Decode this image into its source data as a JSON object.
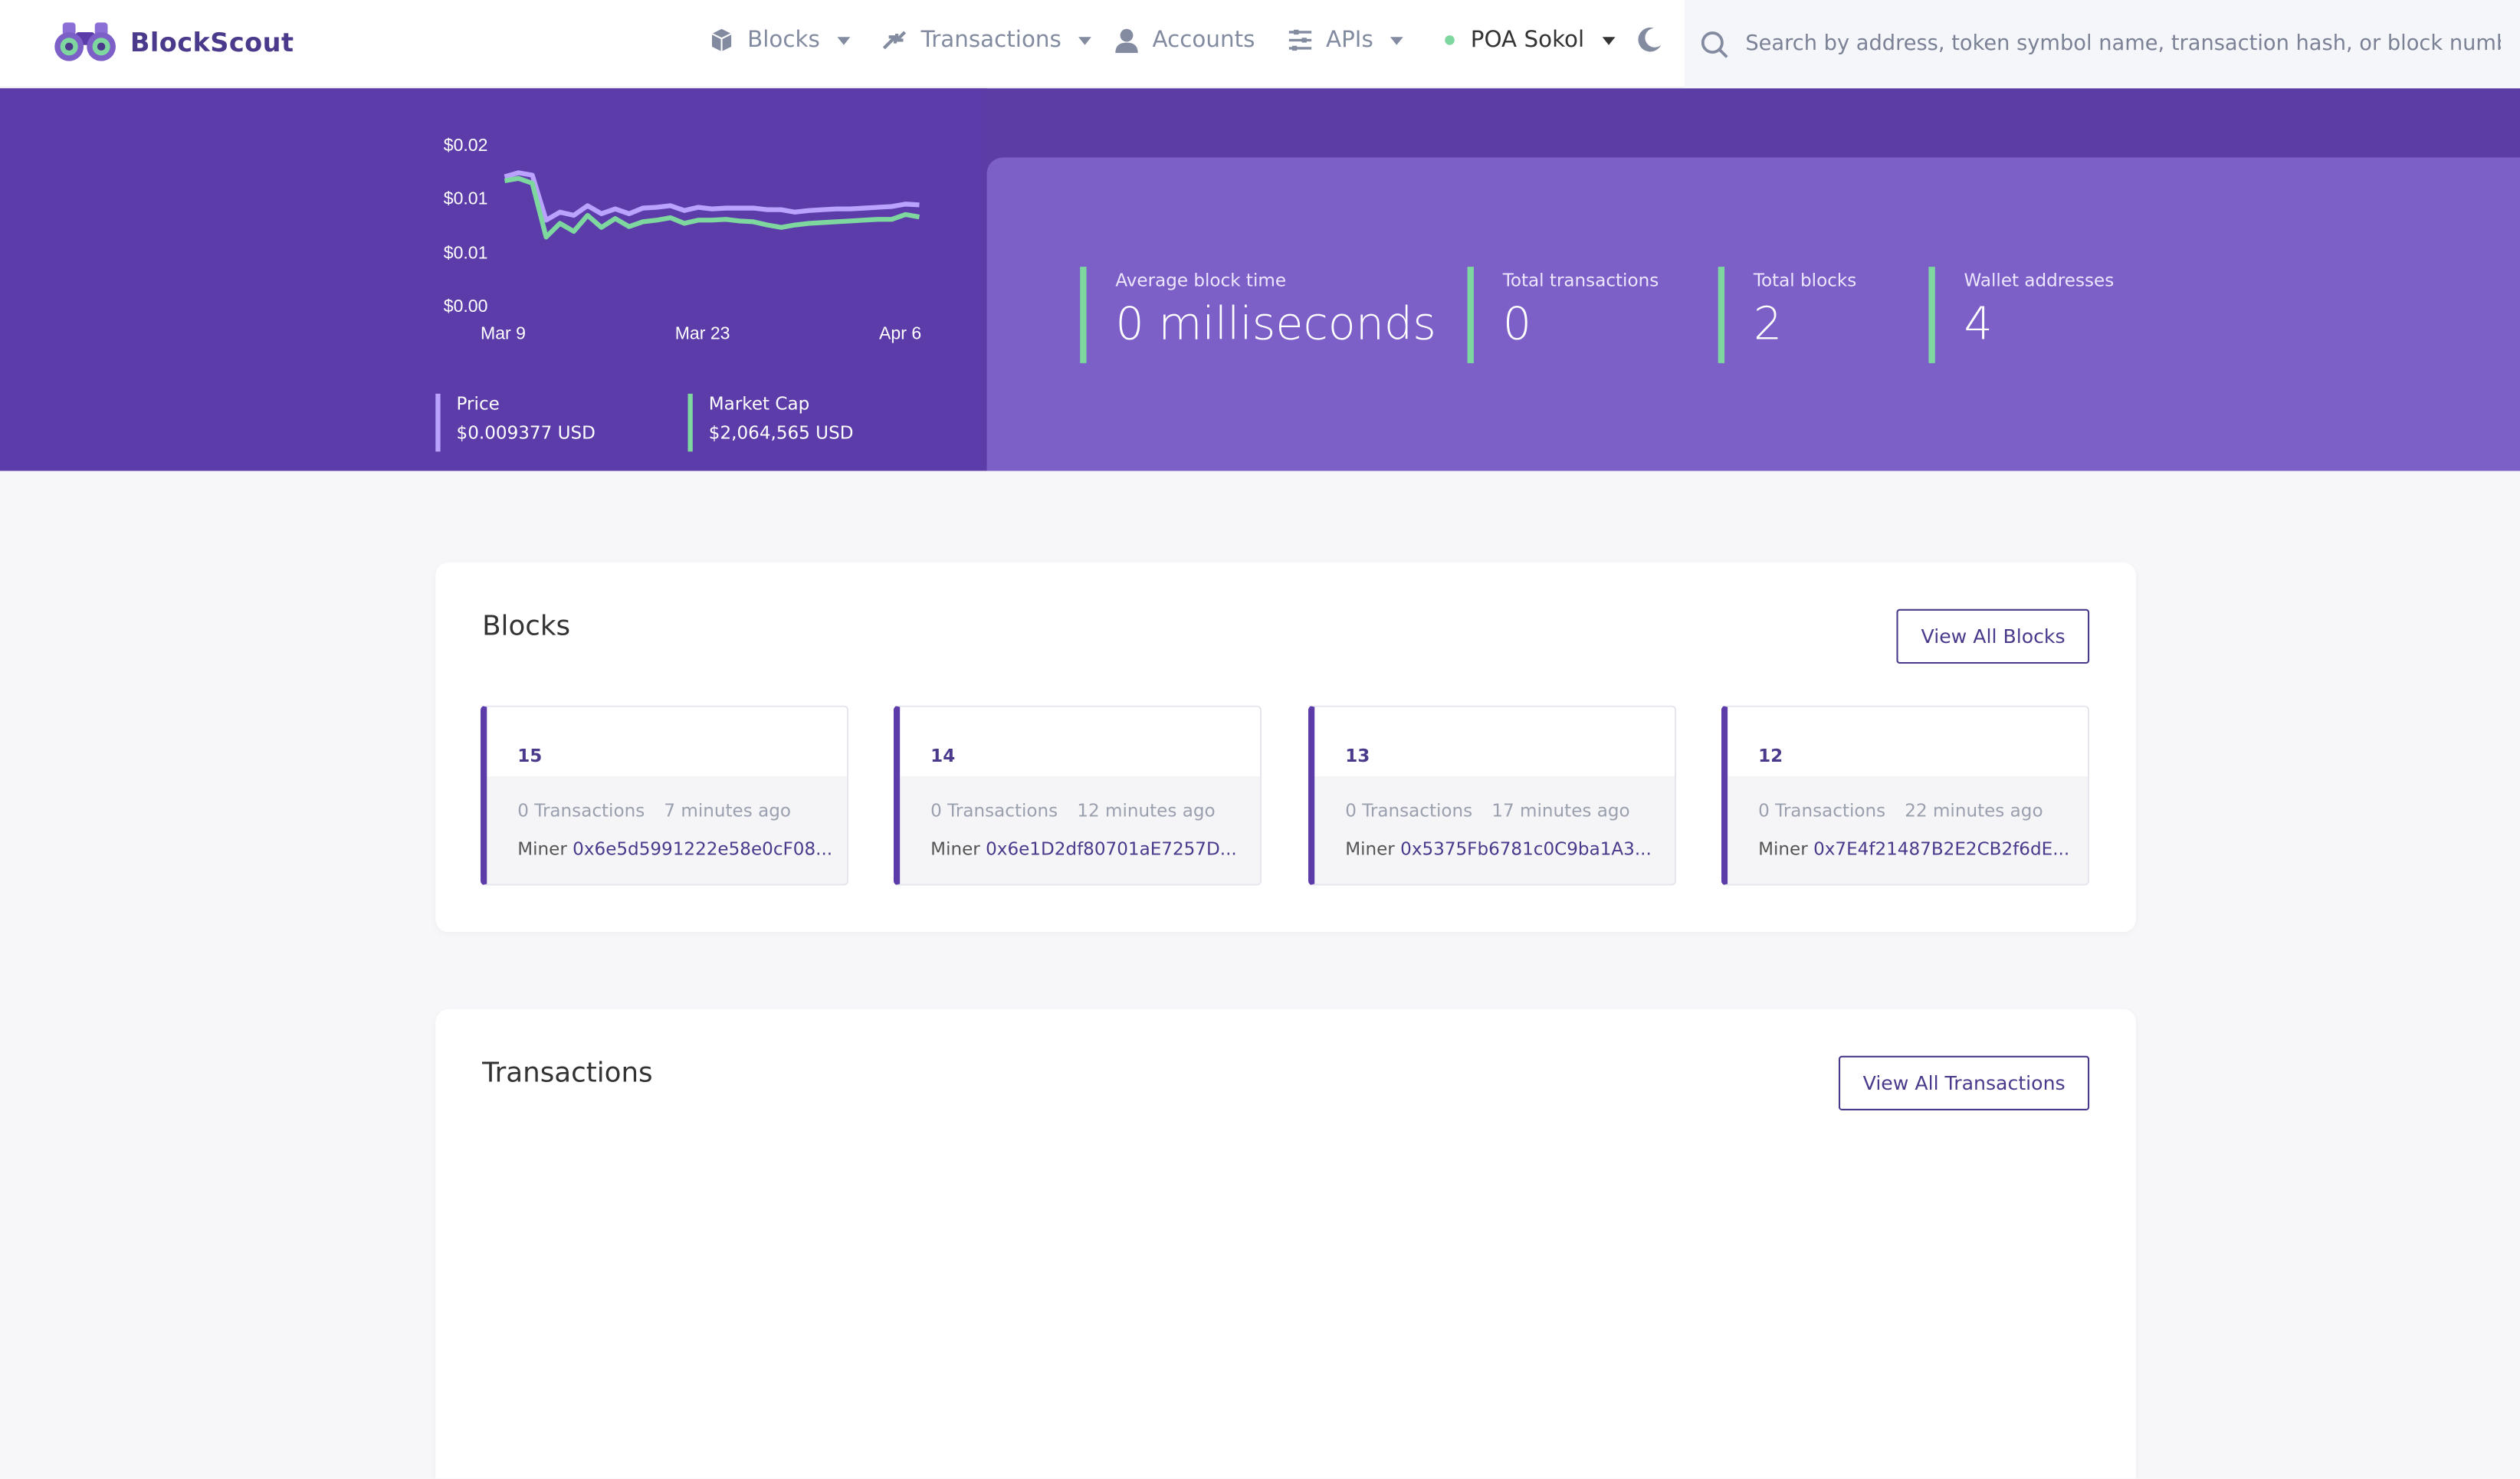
{
  "navbar": {
    "brand": "BlockScout",
    "items": [
      {
        "label": "Blocks",
        "icon": "cube-icon"
      },
      {
        "label": "Transactions",
        "icon": "transfer-icon"
      },
      {
        "label": "Accounts",
        "icon": "user-icon"
      },
      {
        "label": "APIs",
        "icon": "sliders-icon"
      },
      {
        "label": "POA Sokol",
        "icon": "network-dot-icon"
      }
    ],
    "search_placeholder": "Search by address, token symbol name, transaction hash, or block number",
    "colors": {
      "brand": "#4b3a8c",
      "nav_text": "#828ba0"
    }
  },
  "hero": {
    "price_chart": {
      "y_ticks": [
        "$0.02",
        "$0.01",
        "$0.01",
        "$0.00"
      ],
      "x_ticks": [
        "Mar 9",
        "Mar 23",
        "Apr 6"
      ]
    },
    "price": {
      "label": "Price",
      "value": "$0.009377 USD"
    },
    "market_cap": {
      "label": "Market Cap",
      "value": "$2,064,565 USD"
    },
    "stats": [
      {
        "label": "Average block time",
        "value": "0 milliseconds"
      },
      {
        "label": "Total transactions",
        "value": "0"
      },
      {
        "label": "Total blocks",
        "value": "2"
      },
      {
        "label": "Wallet addresses",
        "value": "4"
      }
    ],
    "colors": {
      "hero_bg": "#5c3ca8",
      "panel_bg": "#7c5fc7",
      "accent_green": "#7dd79f",
      "accent_lilac": "#b9a3ff"
    }
  },
  "chart_data": {
    "type": "line",
    "x_labels": [
      "Mar 9",
      "Mar 23",
      "Apr 6"
    ],
    "series": [
      {
        "name": "Price",
        "color": "#b9a3ff",
        "values": [
          0.016,
          0.0165,
          0.0162,
          0.0106,
          0.0116,
          0.0112,
          0.0124,
          0.0114,
          0.012,
          0.0114,
          0.0121,
          0.0122,
          0.0124,
          0.0118,
          0.0122,
          0.012,
          0.0121,
          0.0121,
          0.0121,
          0.0119,
          0.0119,
          0.0116,
          0.0118,
          0.0119,
          0.012,
          0.012,
          0.0121,
          0.0122,
          0.0123,
          0.0126,
          0.0125
        ]
      },
      {
        "name": "Market Cap",
        "color": "#7dd79f",
        "values": [
          0.0155,
          0.0158,
          0.0152,
          0.0085,
          0.0102,
          0.0092,
          0.0112,
          0.0097,
          0.0108,
          0.0098,
          0.0104,
          0.0106,
          0.0109,
          0.0102,
          0.0106,
          0.0106,
          0.0107,
          0.0105,
          0.0104,
          0.01,
          0.0097,
          0.01,
          0.0102,
          0.0103,
          0.0104,
          0.0105,
          0.0106,
          0.0107,
          0.0107,
          0.0113,
          0.011
        ]
      }
    ],
    "ylim": [
      0.0,
      0.02
    ],
    "grid": false,
    "legend": "none"
  },
  "blocks": {
    "title": "Blocks",
    "view_all": "View All Blocks",
    "items": [
      {
        "number": "15",
        "txns": "0 Transactions",
        "age": "7 minutes ago",
        "miner_label": "Miner",
        "miner": "0x6e5d5991222e58e0cF08..."
      },
      {
        "number": "14",
        "txns": "0 Transactions",
        "age": "12 minutes ago",
        "miner_label": "Miner",
        "miner": "0x6e1D2df80701aE7257D..."
      },
      {
        "number": "13",
        "txns": "0 Transactions",
        "age": "17 minutes ago",
        "miner_label": "Miner",
        "miner": "0x5375Fb6781c0C9ba1A3..."
      },
      {
        "number": "12",
        "txns": "0 Transactions",
        "age": "22 minutes ago",
        "miner_label": "Miner",
        "miner": "0x7E4f21487B2E2CB2f6dE..."
      }
    ]
  },
  "transactions": {
    "title": "Transactions",
    "view_all": "View All Transactions"
  }
}
